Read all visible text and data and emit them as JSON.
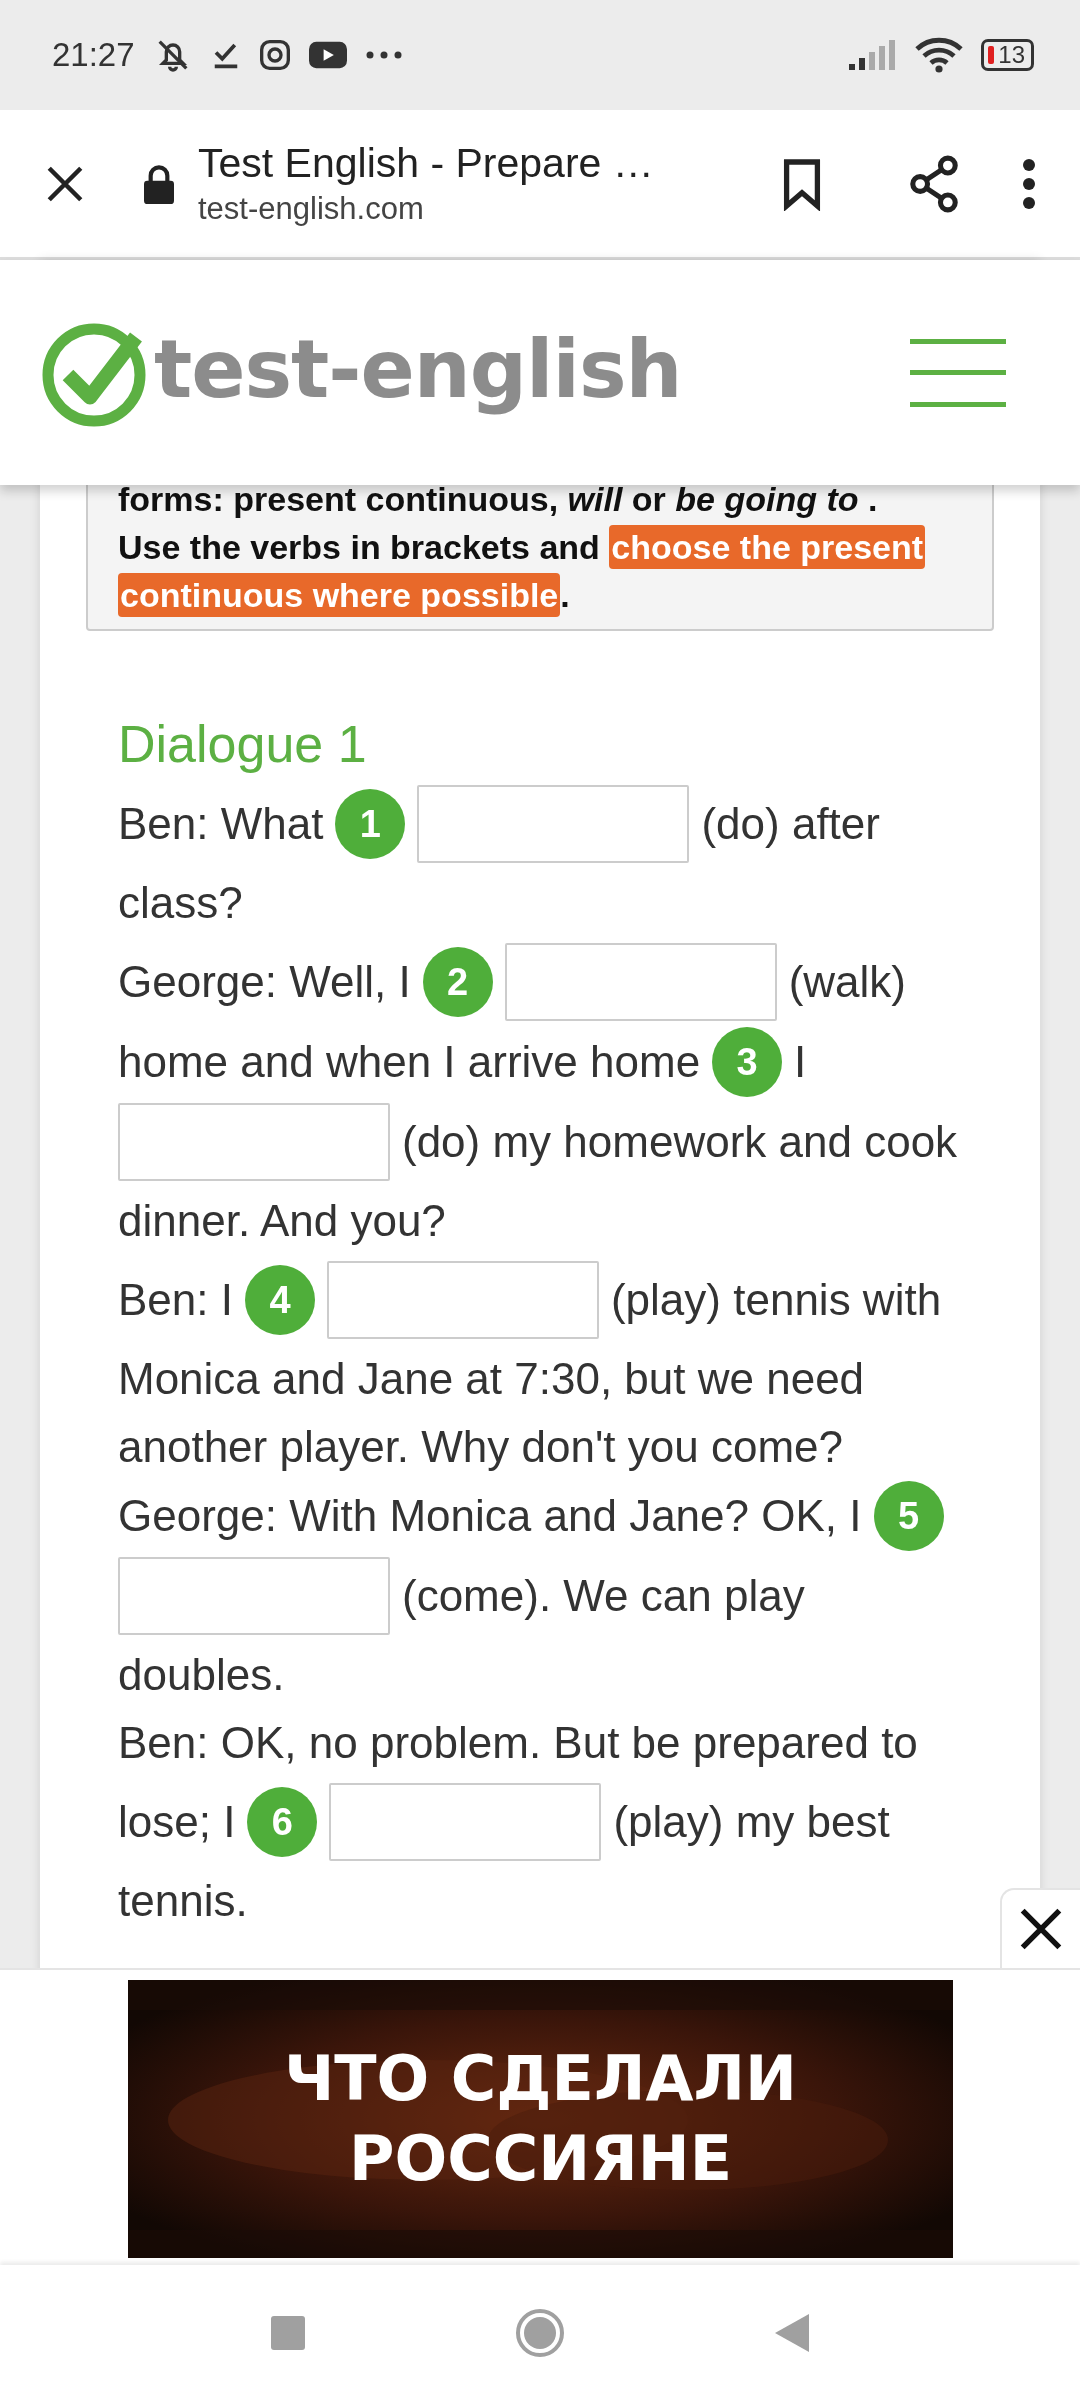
{
  "status_bar": {
    "time": "21:27",
    "battery": "13"
  },
  "browser_bar": {
    "title": "Test English - Prepare …",
    "url": "test-english.com"
  },
  "site_header": {
    "logo": "test-english"
  },
  "instructions": {
    "lines": [
      [
        {
          "kind": "text",
          "text": "forms: present continuous, *will* or *be going to* ."
        }
      ],
      [
        {
          "kind": "text",
          "text": "Use the verbs in brackets and"
        },
        {
          "kind": "highlight",
          "text": "choose the present continuous where possible"
        },
        {
          "kind": "text",
          "text": "."
        }
      ]
    ]
  },
  "dialogue": {
    "title": "Dialogue 1",
    "turns": [
      [
        [
          {
            "kind": "text",
            "text": "Ben: What"
          },
          {
            "kind": "number",
            "text": "1"
          },
          {
            "kind": "field"
          },
          {
            "kind": "text",
            "text": "(do) after"
          }
        ],
        [
          {
            "kind": "text",
            "text": "class?"
          }
        ]
      ],
      [
        [
          {
            "kind": "text",
            "text": "George: Well, I"
          },
          {
            "kind": "number",
            "text": "2"
          },
          {
            "kind": "field"
          },
          {
            "kind": "text",
            "text": "(walk)"
          }
        ],
        [
          {
            "kind": "text",
            "text": "home and when I arrive home"
          },
          {
            "kind": "number",
            "text": "3"
          },
          {
            "kind": "text",
            "text": "I"
          }
        ],
        [
          {
            "kind": "field"
          },
          {
            "kind": "text",
            "text": "(do) my homework and cook"
          }
        ],
        [
          {
            "kind": "text",
            "text": "dinner. And you?"
          }
        ]
      ],
      [
        [
          {
            "kind": "text",
            "text": "Ben: I"
          },
          {
            "kind": "number",
            "text": "4"
          },
          {
            "kind": "field"
          },
          {
            "kind": "text",
            "text": "(play) tennis with"
          }
        ],
        [
          {
            "kind": "text",
            "text": "Monica and Jane at 7:30, but we need"
          }
        ],
        [
          {
            "kind": "text",
            "text": "another player. Why don't you come?"
          }
        ]
      ],
      [
        [
          {
            "kind": "text",
            "text": "George: With Monica and Jane? OK, I"
          },
          {
            "kind": "number",
            "text": "5"
          }
        ],
        [
          {
            "kind": "field"
          },
          {
            "kind": "text",
            "text": "(come). We can play"
          }
        ],
        [
          {
            "kind": "text",
            "text": "doubles."
          }
        ]
      ],
      [
        [
          {
            "kind": "text",
            "text": "Ben: OK, no problem. But be prepared to"
          }
        ],
        [
          {
            "kind": "text",
            "text": "lose; I"
          },
          {
            "kind": "number",
            "text": "6"
          },
          {
            "kind": "field"
          },
          {
            "kind": "text",
            "text": "(play) my best"
          }
        ],
        [
          {
            "kind": "text",
            "text": "tennis."
          }
        ]
      ]
    ]
  },
  "ad": {
    "lines": [
      "ЧТО СДЕЛАЛИ",
      "РОССИЯНЕ"
    ]
  }
}
